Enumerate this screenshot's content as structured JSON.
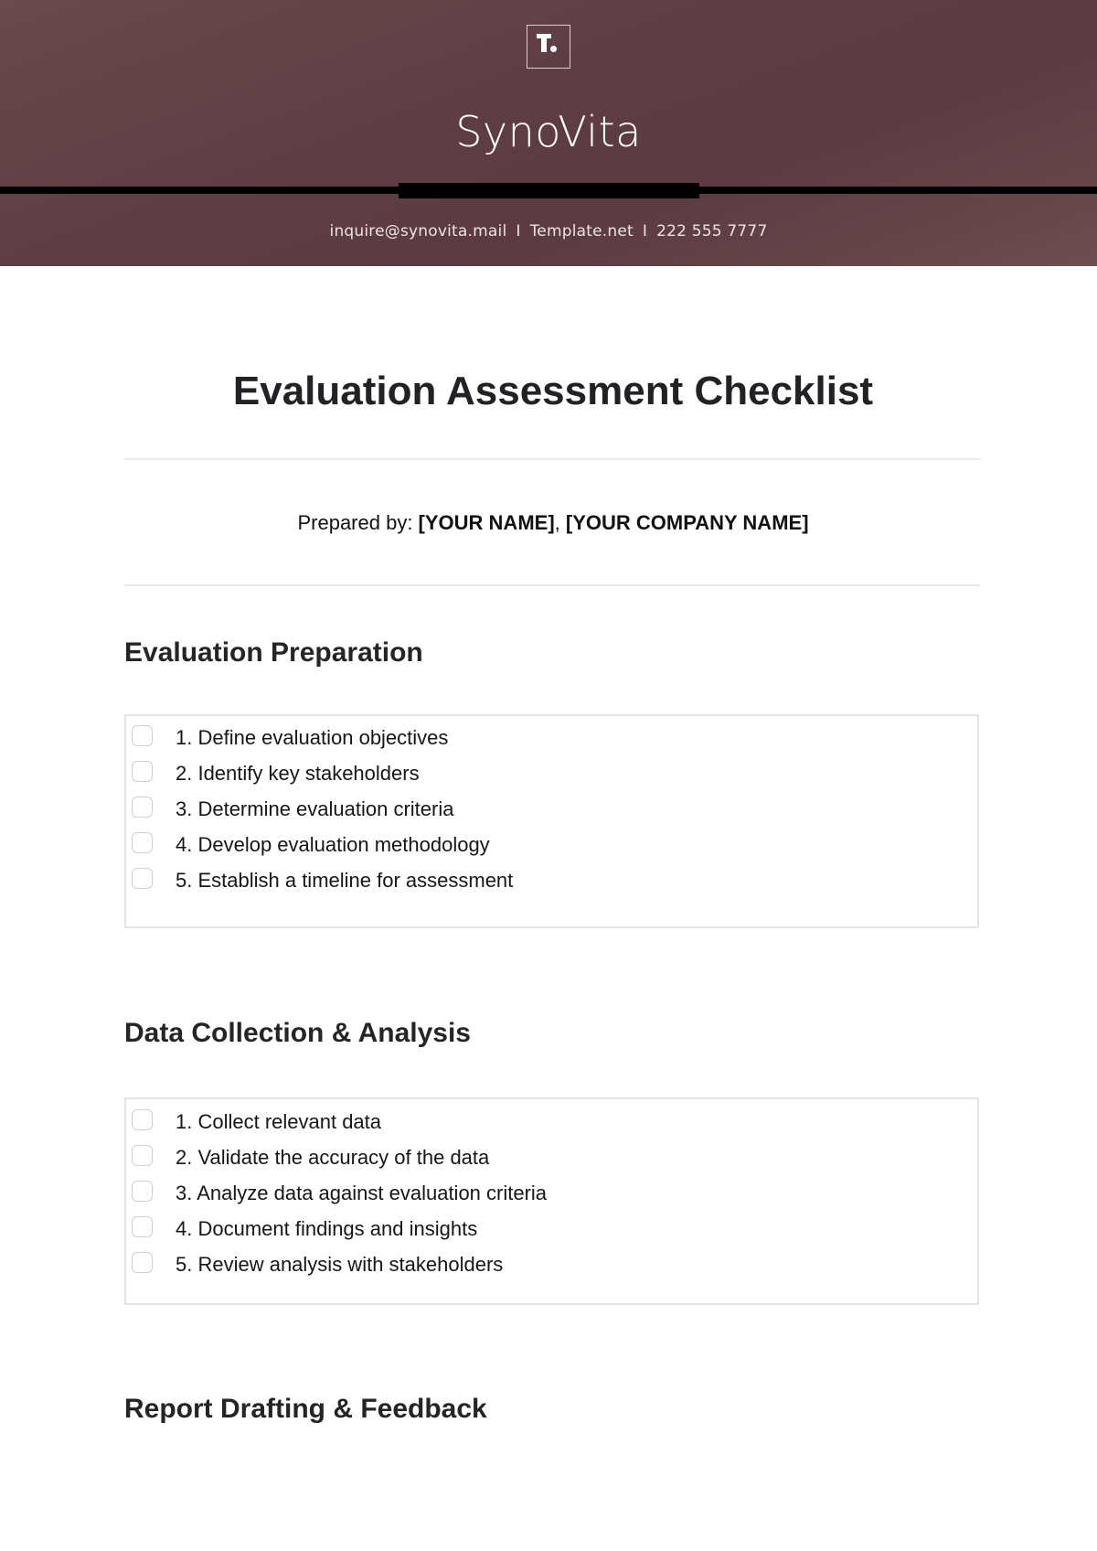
{
  "header": {
    "logo_icon": "template-t-logo-icon",
    "brand_name": "SynoVita",
    "contact": {
      "email": "inquire@synovita.mail",
      "website": "Template.net",
      "phone": "222 555 7777",
      "separator": "I"
    }
  },
  "document": {
    "title": "Evaluation Assessment Checklist",
    "prepared_by": {
      "label": "Prepared by: ",
      "name": "[YOUR NAME]",
      "joiner": ", ",
      "company": "[YOUR COMPANY NAME]"
    },
    "sections": [
      {
        "heading": "Evaluation Preparation",
        "items": [
          {
            "text": "1. Define evaluation objectives",
            "checked": false
          },
          {
            "text": "2. Identify key stakeholders",
            "checked": false
          },
          {
            "text": "3. Determine evaluation criteria",
            "checked": false
          },
          {
            "text": "4. Develop evaluation methodology",
            "checked": false
          },
          {
            "text": "5. Establish a timeline for assessment",
            "checked": false
          }
        ]
      },
      {
        "heading": "Data Collection & Analysis",
        "items": [
          {
            "text": "1. Collect relevant data",
            "checked": false
          },
          {
            "text": "2. Validate the accuracy of the data",
            "checked": false
          },
          {
            "text": "3. Analyze data against evaluation criteria",
            "checked": false
          },
          {
            "text": "4. Document findings and insights",
            "checked": false
          },
          {
            "text": "5. Review analysis with stakeholders",
            "checked": false
          }
        ]
      },
      {
        "heading": "Report Drafting & Feedback",
        "items": []
      }
    ]
  },
  "colors": {
    "header_background": "#5f3d45",
    "header_text": "#ffffff",
    "rule": "#000000",
    "body_text": "#1c1c1e",
    "divider": "#ebebeb",
    "box_border": "#e2e4e6",
    "checkbox_border": "#cfcfcf"
  }
}
